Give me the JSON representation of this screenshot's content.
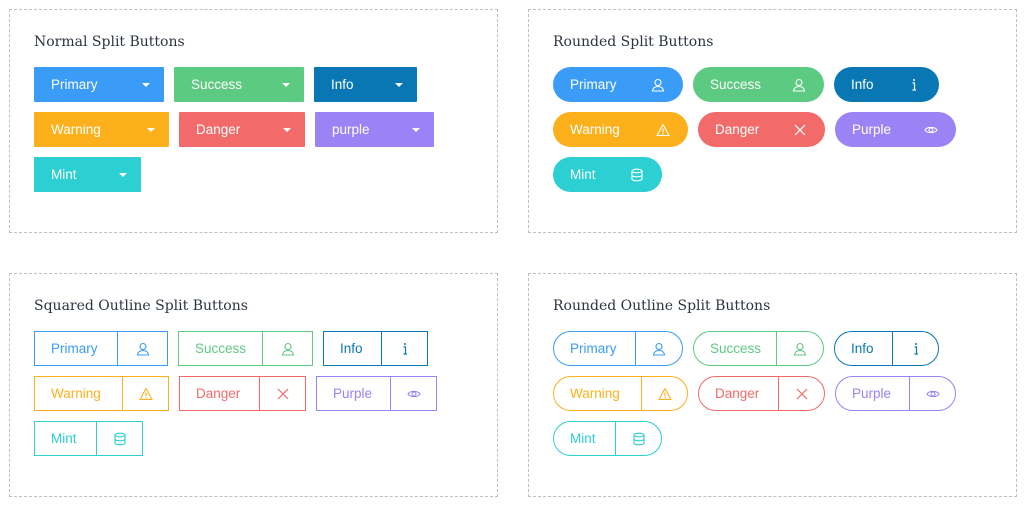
{
  "panels": {
    "normal": {
      "title": "Normal Split Buttons",
      "rows": [
        [
          "Primary",
          "Success",
          "Info"
        ],
        [
          "Warning",
          "Danger",
          "purple"
        ],
        [
          "Mint"
        ]
      ]
    },
    "rounded": {
      "title": "Rounded Split Buttons",
      "rows": [
        [
          "Primary",
          "Success",
          "Info"
        ],
        [
          "Warning",
          "Danger",
          "Purple"
        ],
        [
          "Mint"
        ]
      ]
    },
    "squared_outline": {
      "title": "Squared Outline Split Buttons",
      "rows": [
        [
          "Primary",
          "Success",
          "Info"
        ],
        [
          "Warning",
          "Danger",
          "Purple"
        ],
        [
          "Mint"
        ]
      ]
    },
    "rounded_outline": {
      "title": "Rounded Outline Split Buttons",
      "rows": [
        [
          "Primary",
          "Success",
          "Info"
        ],
        [
          "Warning",
          "Danger",
          "Purple"
        ],
        [
          "Mint"
        ]
      ]
    }
  },
  "icons": {
    "Primary": "user-icon",
    "Success": "user-icon",
    "Info": "info-icon",
    "Warning": "warning-icon",
    "Danger": "close-icon",
    "Purple": "eye-icon",
    "Mint": "database-icon"
  },
  "colors": {
    "primary": "#3a9cf7",
    "success": "#5dca82",
    "info": "#0a77b5",
    "warning": "#fcb11c",
    "danger": "#f36a6a",
    "purple": "#9b82f5",
    "mint": "#2ccfd2"
  }
}
